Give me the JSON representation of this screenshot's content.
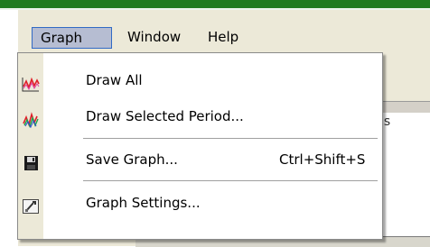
{
  "menubar": {
    "items": [
      {
        "label": "Graph",
        "active": true
      },
      {
        "label": "Window",
        "active": false
      },
      {
        "label": "Help",
        "active": false
      }
    ]
  },
  "graph_menu": {
    "items": [
      {
        "label": "Draw All",
        "icon": "draw-all-chart-icon",
        "shortcut": ""
      },
      {
        "label": "Draw Selected Period...",
        "icon": "draw-selected-chart-icon",
        "shortcut": ""
      },
      {
        "label": "Save Graph...",
        "icon": "floppy-disk-icon",
        "shortcut": "Ctrl+Shift+S"
      },
      {
        "label": "Graph Settings...",
        "icon": "settings-tool-icon",
        "shortcut": ""
      }
    ]
  },
  "background": {
    "peek_text": "is"
  },
  "colors": {
    "title_green": "#1f7a1f",
    "menu_bg": "#ece9d8",
    "active_highlight": "#b6bdd2",
    "active_border": "#316ac5"
  }
}
